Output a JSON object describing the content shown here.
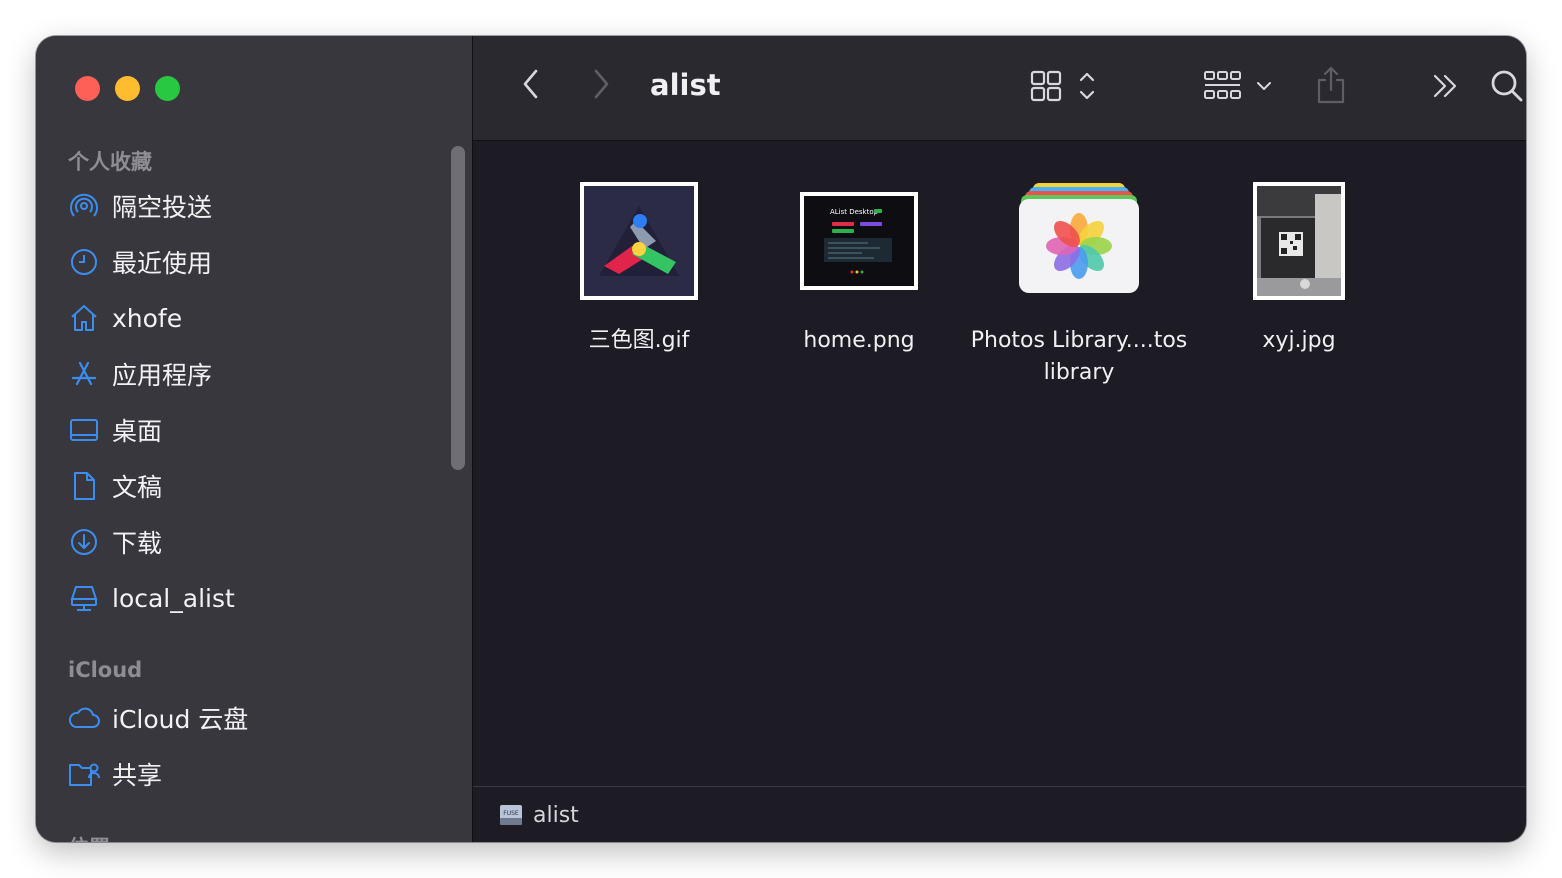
{
  "window": {
    "title": "alist"
  },
  "sidebar": {
    "favorites_title": "个人收藏",
    "favorites": [
      {
        "label": "隔空投送",
        "icon": "airdrop-icon"
      },
      {
        "label": "最近使用",
        "icon": "clock-icon"
      },
      {
        "label": "xhofe",
        "icon": "home-icon"
      },
      {
        "label": "应用程序",
        "icon": "applications-icon"
      },
      {
        "label": "桌面",
        "icon": "desktop-icon"
      },
      {
        "label": "文稿",
        "icon": "document-icon"
      },
      {
        "label": "下载",
        "icon": "download-icon"
      },
      {
        "label": "local_alist",
        "icon": "network-drive-icon"
      }
    ],
    "icloud_title": "iCloud",
    "icloud": [
      {
        "label": "iCloud 云盘",
        "icon": "cloud-icon"
      },
      {
        "label": "共享",
        "icon": "shared-folder-icon"
      }
    ],
    "locations_title_partial": "位置"
  },
  "toolbar": {
    "back": "chevron-left-icon",
    "forward": "chevron-right-icon",
    "view_mode": "icon-grid-icon",
    "group": "group-grid-icon",
    "share": "share-icon",
    "more": "double-chevron-right-icon",
    "search": "search-icon"
  },
  "files": [
    {
      "name": "三色图.gif",
      "kind": "gif-thumbnail"
    },
    {
      "name": "home.png",
      "kind": "png-thumbnail",
      "thumb_text": "AList Desktop"
    },
    {
      "name": "Photos Library....toslibrary",
      "kind": "photos-library-icon"
    },
    {
      "name": "xyj.jpg",
      "kind": "jpg-thumbnail"
    }
  ],
  "statusbar": {
    "path": "alist",
    "disk_icon_text": "FUSE"
  },
  "colors": {
    "accent": "#3b8ef0",
    "sidebar_bg": "#38373d",
    "content_bg": "#1d1b23",
    "close": "#fe5f57",
    "minimize": "#febc2e",
    "zoom": "#28c840"
  }
}
